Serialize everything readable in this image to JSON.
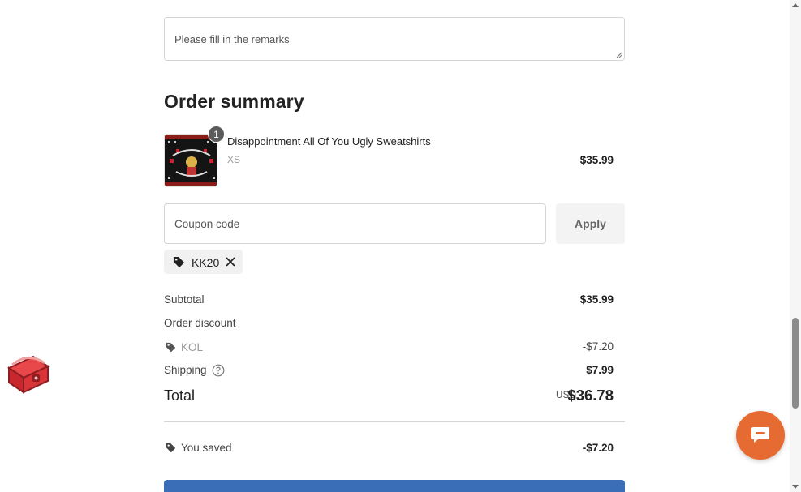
{
  "remarks": {
    "placeholder": "Please fill in the remarks"
  },
  "order_summary": {
    "title": "Order summary",
    "item": {
      "quantity": "1",
      "name": "Disappointment All Of You Ugly Sweatshirts",
      "variant": "XS",
      "price": "$35.99"
    }
  },
  "coupon": {
    "placeholder": "Coupon code",
    "apply_label": "Apply",
    "applied_code": "KK20"
  },
  "totals": {
    "subtotal_label": "Subtotal",
    "subtotal_value": "$35.99",
    "order_discount_label": "Order discount",
    "discount_code": "KOL",
    "discount_value": "-$7.20",
    "shipping_label": "Shipping",
    "shipping_value": "$7.99",
    "total_label": "Total",
    "currency": "USD",
    "total_value": "$36.78",
    "saved_label": "You saved",
    "saved_value": "-$7.20"
  },
  "colors": {
    "chat_button": "#e66b32",
    "checkout_button": "#3a6fb7",
    "tag_chip_bg": "#f1f1f1"
  },
  "icons": {
    "tag": "tag-icon",
    "remove": "close-icon",
    "help": "question-circle-icon",
    "chat": "chat-bubble-icon",
    "reward": "treasure-chest-icon"
  }
}
